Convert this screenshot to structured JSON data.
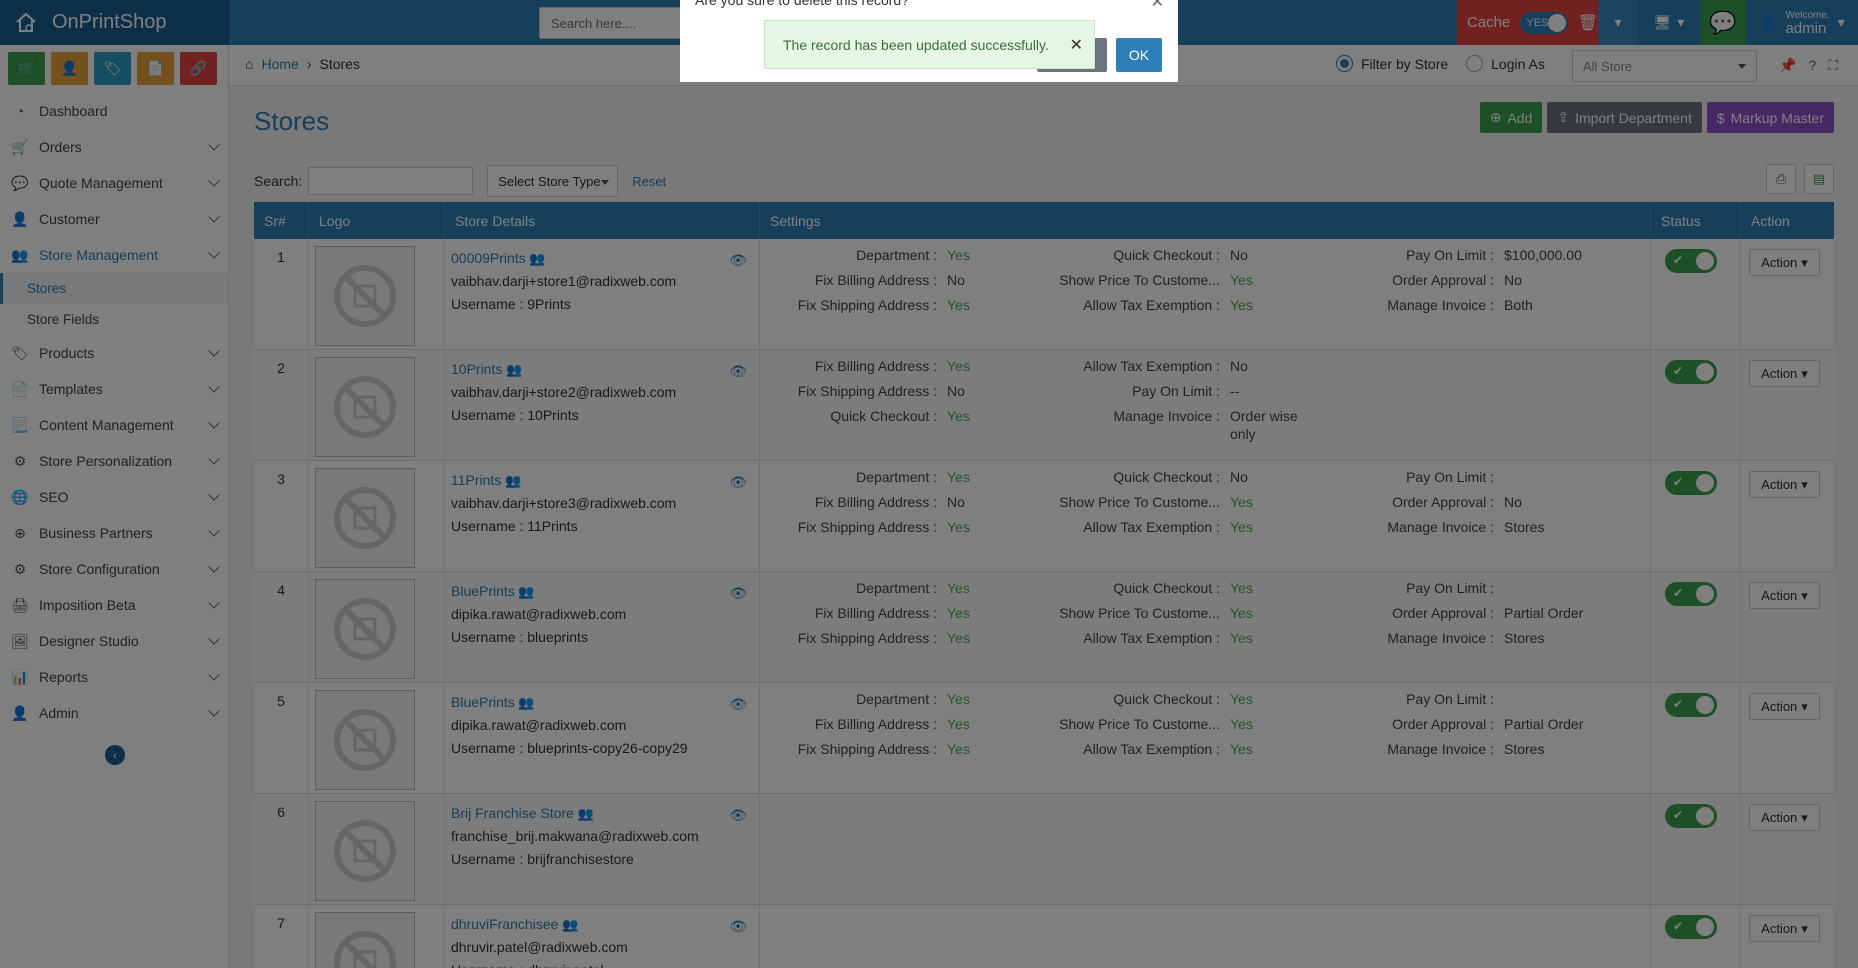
{
  "brand": {
    "name": "OnPrintShop"
  },
  "topbar": {
    "search_placeholder": "Search here....",
    "cache_label": "Cache",
    "cache_toggle": "YES",
    "welcome": "Welcome,",
    "username": "admin"
  },
  "quick_buttons": [
    {
      "icon": "cart-icon",
      "color": "#3aa04d"
    },
    {
      "icon": "user-icon",
      "color": "#e8a33a"
    },
    {
      "icon": "tag-icon",
      "color": "#2d9fc8"
    },
    {
      "icon": "document-icon",
      "color": "#e8a33a"
    },
    {
      "icon": "link-icon",
      "color": "#e64545"
    }
  ],
  "sidebar": {
    "items": [
      {
        "label": "Dashboard",
        "icon": "dashboard-icon",
        "chevron": false
      },
      {
        "label": "Orders",
        "icon": "cart-icon",
        "chevron": true
      },
      {
        "label": "Quote Management",
        "icon": "chat-icon",
        "chevron": true
      },
      {
        "label": "Customer",
        "icon": "user-icon",
        "chevron": true
      },
      {
        "label": "Store Management",
        "icon": "users-icon",
        "chevron": true,
        "active": true
      },
      {
        "label": "Products",
        "icon": "tags-icon",
        "chevron": true
      },
      {
        "label": "Templates",
        "icon": "pdf-icon",
        "chevron": true
      },
      {
        "label": "Content Management",
        "icon": "file-icon",
        "chevron": true
      },
      {
        "label": "Store Personalization",
        "icon": "gear-icon",
        "chevron": true
      },
      {
        "label": "SEO",
        "icon": "globe-icon",
        "chevron": true
      },
      {
        "label": "Business Partners",
        "icon": "partners-icon",
        "chevron": true
      },
      {
        "label": "Store Configuration",
        "icon": "gears-icon",
        "chevron": true
      },
      {
        "label": "Imposition Beta",
        "icon": "print-icon",
        "chevron": true
      },
      {
        "label": "Designer Studio",
        "icon": "image-icon",
        "chevron": true
      },
      {
        "label": "Reports",
        "icon": "chart-icon",
        "chevron": true
      },
      {
        "label": "Admin",
        "icon": "admin-icon",
        "chevron": true
      }
    ],
    "sub_items": [
      {
        "label": "Stores",
        "active": true
      },
      {
        "label": "Store Fields",
        "active": false
      }
    ]
  },
  "breadcrumb": {
    "home": "Home",
    "current": "Stores"
  },
  "filter": {
    "by_store": "Filter by Store",
    "login_as": "Login As",
    "store_select": "All Store"
  },
  "page": {
    "title": "Stores",
    "add": "Add",
    "import": "Import Department",
    "markup": "Markup Master",
    "search_label": "Search:",
    "store_type": "Select Store Type",
    "reset": "Reset"
  },
  "table": {
    "headers": [
      "Sr#",
      "Logo",
      "Store Details",
      "Settings",
      "Status",
      "Action"
    ],
    "action_label": "Action",
    "rows": [
      {
        "sr": "1",
        "name": "00009Prints",
        "email": "vaibhav.darji+store1@radixweb.com",
        "username": "Username : 9Prints",
        "col1": [
          [
            "Department :",
            "Yes"
          ],
          [
            "Fix Billing Address :",
            "No"
          ],
          [
            "Fix Shipping Address :",
            "Yes"
          ]
        ],
        "col2": [
          [
            "Quick Checkout :",
            "No"
          ],
          [
            "Show Price To Custome...",
            "Yes"
          ],
          [
            "Allow Tax Exemption :",
            "Yes"
          ]
        ],
        "col3": [
          [
            "Pay On Limit :",
            "$100,000.00"
          ],
          [
            "Order Approval :",
            "No"
          ],
          [
            "Manage Invoice :",
            "Both"
          ]
        ]
      },
      {
        "sr": "2",
        "name": "10Prints",
        "email": "vaibhav.darji+store2@radixweb.com",
        "username": "Username : 10Prints",
        "col1": [
          [
            "Fix Billing Address :",
            "Yes"
          ],
          [
            "Fix Shipping Address :",
            "No"
          ],
          [
            "Quick Checkout :",
            "Yes"
          ]
        ],
        "col2": [
          [
            "Allow Tax Exemption :",
            "No"
          ],
          [
            "Pay On Limit :",
            "--"
          ],
          [
            "Manage Invoice :",
            "Order wise only"
          ]
        ],
        "col3": []
      },
      {
        "sr": "3",
        "name": "11Prints",
        "email": "vaibhav.darji+store3@radixweb.com",
        "username": "Username : 11Prints",
        "col1": [
          [
            "Department :",
            "Yes"
          ],
          [
            "Fix Billing Address :",
            "No"
          ],
          [
            "Fix Shipping Address :",
            "Yes"
          ]
        ],
        "col2": [
          [
            "Quick Checkout :",
            "No"
          ],
          [
            "Show Price To Custome...",
            "Yes"
          ],
          [
            "Allow Tax Exemption :",
            "Yes"
          ]
        ],
        "col3": [
          [
            "Pay On Limit :",
            ""
          ],
          [
            "Order Approval :",
            "No"
          ],
          [
            "Manage Invoice :",
            "Stores"
          ]
        ]
      },
      {
        "sr": "4",
        "name": "BluePrints",
        "email": "dipika.rawat@radixweb.com",
        "username": "Username : blueprints",
        "col1": [
          [
            "Department :",
            "Yes"
          ],
          [
            "Fix Billing Address :",
            "Yes"
          ],
          [
            "Fix Shipping Address :",
            "Yes"
          ]
        ],
        "col2": [
          [
            "Quick Checkout :",
            "Yes"
          ],
          [
            "Show Price To Custome...",
            "Yes"
          ],
          [
            "Allow Tax Exemption :",
            "Yes"
          ]
        ],
        "col3": [
          [
            "Pay On Limit :",
            ""
          ],
          [
            "Order Approval :",
            "Partial Order"
          ],
          [
            "Manage Invoice :",
            "Stores"
          ]
        ]
      },
      {
        "sr": "5",
        "name": "BluePrints",
        "email": "dipika.rawat@radixweb.com",
        "username": "Username : blueprints-copy26-copy29",
        "col1": [
          [
            "Department :",
            "Yes"
          ],
          [
            "Fix Billing Address :",
            "Yes"
          ],
          [
            "Fix Shipping Address :",
            "Yes"
          ]
        ],
        "col2": [
          [
            "Quick Checkout :",
            "Yes"
          ],
          [
            "Show Price To Custome...",
            "Yes"
          ],
          [
            "Allow Tax Exemption :",
            "Yes"
          ]
        ],
        "col3": [
          [
            "Pay On Limit :",
            ""
          ],
          [
            "Order Approval :",
            "Partial Order"
          ],
          [
            "Manage Invoice :",
            "Stores"
          ]
        ]
      },
      {
        "sr": "6",
        "name": "Brij Franchise Store",
        "email": "franchise_brij.makwana@radixweb.com",
        "username": "Username : brijfranchisestore",
        "col1": [],
        "col2": [],
        "col3": []
      },
      {
        "sr": "7",
        "name": "dhruviFranchisee",
        "email": "dhruvir.patel@radixweb.com",
        "username": "Username : dhruvir.patel",
        "col1": [],
        "col2": [],
        "col3": []
      }
    ]
  },
  "modal": {
    "question": "Are you sure to delete this record?",
    "ok": "OK",
    "toast": "The record has been updated successfully."
  }
}
